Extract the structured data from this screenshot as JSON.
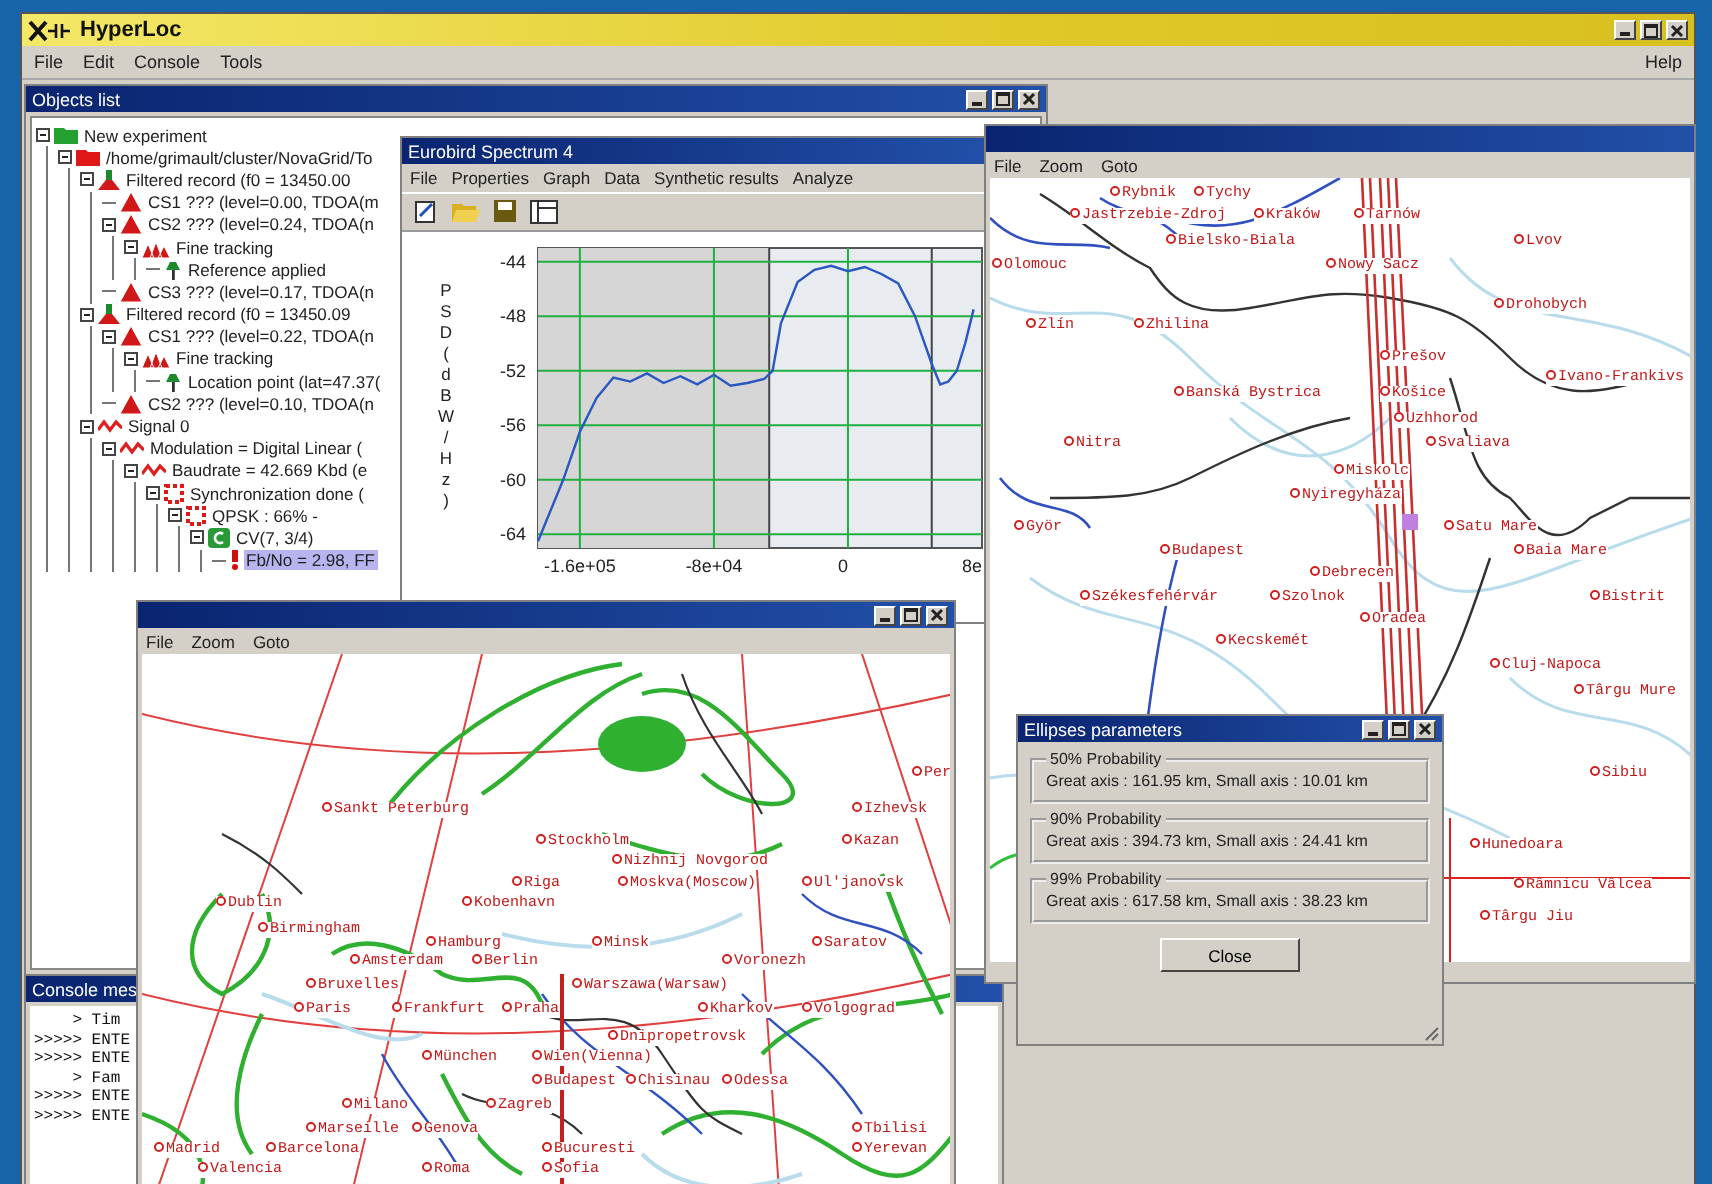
{
  "window": {
    "title": "HyperLoc",
    "menu": [
      "File",
      "Edit",
      "Console",
      "Tools"
    ],
    "help": "Help"
  },
  "objects_list": {
    "title": "Objects list",
    "tree": [
      {
        "label": "New experiment",
        "kind": "experiment",
        "expanded": true,
        "selected": false,
        "children": [
          {
            "label": "/home/grimault/cluster/NovaGrid/To",
            "kind": "folder",
            "expanded": true,
            "selected": false,
            "children": [
              {
                "label": "Filtered record (f0 = 13450.00",
                "kind": "record",
                "expanded": true,
                "selected": false,
                "children": [
                  {
                    "label": "CS1 ??? (level=0.00, TDOA(m",
                    "kind": "triangle",
                    "selected": false
                  },
                  {
                    "label": "CS2 ??? (level=0.24, TDOA(n",
                    "kind": "triangle",
                    "expanded": true,
                    "selected": false,
                    "children": [
                      {
                        "label": "Fine tracking",
                        "kind": "tracking",
                        "expanded": true,
                        "selected": false,
                        "children": [
                          {
                            "label": "Reference applied",
                            "kind": "pin",
                            "selected": false
                          }
                        ]
                      }
                    ]
                  },
                  {
                    "label": "CS3 ??? (level=0.17, TDOA(n",
                    "kind": "triangle",
                    "selected": false
                  }
                ]
              },
              {
                "label": "Filtered record (f0 = 13450.09",
                "kind": "record",
                "expanded": true,
                "selected": false,
                "children": [
                  {
                    "label": "CS1 ??? (level=0.22, TDOA(n",
                    "kind": "triangle",
                    "expanded": true,
                    "selected": false,
                    "children": [
                      {
                        "label": "Fine tracking",
                        "kind": "tracking",
                        "expanded": true,
                        "selected": false,
                        "children": [
                          {
                            "label": "Location point (lat=47.37(",
                            "kind": "pin",
                            "selected": false
                          }
                        ]
                      }
                    ]
                  },
                  {
                    "label": "CS2 ??? (level=0.10, TDOA(n",
                    "kind": "triangle",
                    "selected": false
                  }
                ]
              },
              {
                "label": "Signal 0",
                "kind": "signal",
                "expanded": true,
                "selected": false,
                "children": [
                  {
                    "label": "Modulation = Digital Linear (",
                    "kind": "signal",
                    "expanded": true,
                    "selected": false,
                    "children": [
                      {
                        "label": "Baudrate = 42.669 Kbd (e",
                        "kind": "signal",
                        "expanded": true,
                        "selected": false,
                        "children": [
                          {
                            "label": "Synchronization done (",
                            "kind": "sync",
                            "expanded": true,
                            "selected": false,
                            "children": [
                              {
                                "label": "QPSK : 66% -",
                                "kind": "sync",
                                "expanded": true,
                                "selected": false,
                                "children": [
                                  {
                                    "label": "CV(7, 3/4)",
                                    "kind": "code",
                                    "expanded": true,
                                    "selected": false,
                                    "children": [
                                      {
                                        "label": "Fb/No = 2.98, FF",
                                        "kind": "alert",
                                        "selected": true
                                      }
                                    ]
                                  }
                                ]
                              }
                            ]
                          }
                        ]
                      }
                    ]
                  }
                ]
              }
            ]
          }
        ]
      }
    ]
  },
  "console": {
    "title": "Console mes",
    "lines": [
      "    > Tim",
      ">>>>> ENTE",
      ">>>>> ENTE",
      "    > Fam",
      ">>>>> ENTE",
      ">>>>> ENTE"
    ]
  },
  "spectrum": {
    "title": "Eurobird Spectrum 4",
    "cut_tick_label": "8e",
    "menu": [
      "File",
      "Properties",
      "Graph",
      "Data",
      "Synthetic results",
      "Analyze"
    ],
    "chart_data": {
      "type": "line",
      "grid": true,
      "bands": [
        {
          "axis": "x",
          "from": -185000,
          "to": -47000,
          "color": "#d6d6d6"
        }
      ],
      "ref_lines": [
        {
          "axis": "x",
          "value": -47000
        },
        {
          "axis": "x",
          "value": 50000
        }
      ],
      "ylabel": "PSD(dBW/Hz)",
      "xlim": [
        -185000,
        80000
      ],
      "ylim": [
        -65,
        -43
      ],
      "yticks": [
        -44,
        -48,
        -52,
        -56,
        -60,
        -64
      ],
      "xticks": [
        {
          "value": -160000,
          "label": "-1.6e+05"
        },
        {
          "value": -80000,
          "label": "-8e+04"
        },
        0
      ],
      "x": [
        -185000,
        -180000,
        -170000,
        -160000,
        -150000,
        -140000,
        -130000,
        -120000,
        -110000,
        -100000,
        -90000,
        -80000,
        -70000,
        -60000,
        -50000,
        -45000,
        -40000,
        -30000,
        -20000,
        -10000,
        0,
        10000,
        20000,
        30000,
        40000,
        50000,
        55000,
        60000,
        65000,
        70000,
        75000
      ],
      "values": [
        -64.5,
        -63,
        -60,
        -56.5,
        -54,
        -52.5,
        -52.8,
        -52.2,
        -52.9,
        -52.4,
        -53,
        -52.3,
        -53.1,
        -52.9,
        -52.6,
        -52,
        -48.5,
        -45.5,
        -44.6,
        -44.3,
        -44.7,
        -44.4,
        -44.9,
        -45.6,
        -48,
        -51.5,
        -53,
        -52.8,
        -52,
        -50,
        -47.5
      ]
    }
  },
  "map_right": {
    "menu": [
      "File",
      "Zoom",
      "Goto"
    ],
    "cities": [
      "Rybnik",
      "Tychy",
      "Jastrzebie-Zdroj",
      "Kraków",
      "Tarnów",
      "Bielsko-Biala",
      "Lvov",
      "Olomouc",
      "Nowy Sacz",
      "Drohobych",
      "Zlín",
      "Zhilina",
      "Prešov",
      "Ivano-Frankivs",
      "Banská Bystrica",
      "Košice",
      "Uzhhorod",
      "Nitra",
      "Svaliava",
      "Miskolc",
      "Nyiregyháza",
      "Györ",
      "Satu Mare",
      "Budapest",
      "Baia Mare",
      "Debrecen",
      "Székesfehérvár",
      "Szolnok",
      "Bistrit",
      "Oradea",
      "Kecskemét",
      "Cluj-Napoca",
      "Târgu Mure",
      "Sibiu",
      "Hunedoara",
      "Râmnicu Vâlcea",
      "Târgu Jiu"
    ]
  },
  "map_bottom": {
    "menu": [
      "File",
      "Zoom",
      "Goto"
    ],
    "cities": [
      "Per",
      "Sankt Peterburg",
      "Izhevsk",
      "Stockholm",
      "Kazan",
      "Nizhnij Novgorod",
      "Riga",
      "Moskva(Moscow)",
      "Ul'janovsk",
      "Dublin",
      "Kobenhavn",
      "Birmingham",
      "Hamburg",
      "Minsk",
      "Saratov",
      "Amsterdam",
      "Berlin",
      "Voronezh",
      "Bruxelles",
      "Warszawa(Warsaw)",
      "Paris",
      "Frankfurt",
      "Praha",
      "Kharkov",
      "Volgograd",
      "Dnipropetrovsk",
      "München",
      "Wien(Vienna)",
      "Budapest",
      "Chisinau",
      "Odessa",
      "Milano",
      "Zagreb",
      "Marseille",
      "Genova",
      "Tbilisi",
      "Madrid",
      "Barcelona",
      "Bucuresti",
      "Yerevan",
      "Valencia",
      "Roma",
      "Sofia"
    ]
  },
  "ellipses": {
    "title": "Ellipses parameters",
    "groups": [
      {
        "label": "50% Probability",
        "text": "Great axis : 161.95 km, Small axis : 10.01 km"
      },
      {
        "label": "90% Probability",
        "text": "Great axis : 394.73 km, Small axis : 24.41 km"
      },
      {
        "label": "99% Probability",
        "text": "Great axis : 617.58 km, Small axis : 38.23 km"
      }
    ],
    "close": "Close"
  }
}
